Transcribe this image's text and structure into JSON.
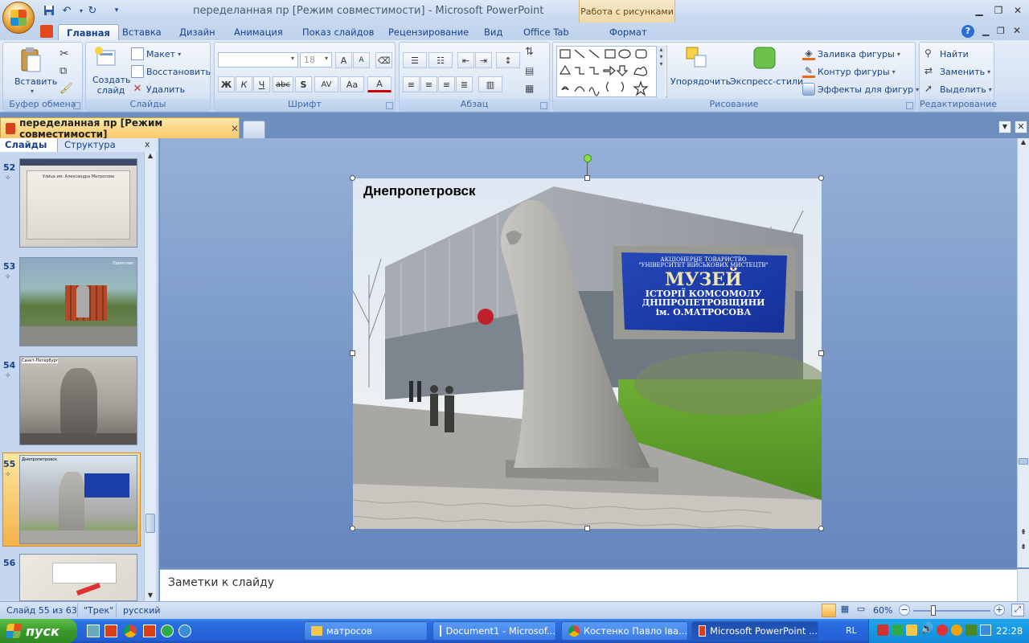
{
  "titlebar": {
    "title": "переделанная пр [Режим совместимости] - Microsoft PowerPoint",
    "context_tab_title": "Работа с рисунками"
  },
  "tabs": [
    {
      "label": "Главная",
      "active": true
    },
    {
      "label": "Вставка"
    },
    {
      "label": "Дизайн"
    },
    {
      "label": "Анимация"
    },
    {
      "label": "Показ слайдов"
    },
    {
      "label": "Рецензирование"
    },
    {
      "label": "Вид"
    },
    {
      "label": "Office Tab"
    },
    {
      "label": "Формат"
    }
  ],
  "ribbon": {
    "clipboard": {
      "label": "Буфер обмена",
      "paste": "Вставить"
    },
    "slides": {
      "label": "Слайды",
      "new_slide": "Создать слайд",
      "layout": "Макет",
      "reset": "Восстановить",
      "delete": "Удалить"
    },
    "font": {
      "label": "Шрифт",
      "size": "18",
      "grow": "A",
      "shrink": "A",
      "bold": "Ж",
      "italic": "К",
      "underline": "Ч",
      "strike": "abc",
      "shadow": "S",
      "spacing": "AV",
      "case": "Aa",
      "color": "A"
    },
    "paragraph": {
      "label": "Абзац"
    },
    "drawing": {
      "label": "Рисование",
      "arrange": "Упорядочить",
      "quick_styles": "Экспресс-стили",
      "fill": "Заливка фигуры",
      "outline": "Контур фигуры",
      "effects": "Эффекты для фигур"
    },
    "editing": {
      "label": "Редактирование",
      "find": "Найти",
      "replace": "Заменить",
      "select": "Выделить"
    }
  },
  "doc_tab": {
    "title": "переделанная пр [Режим совместимости]"
  },
  "panel": {
    "tab_slides": "Слайды",
    "tab_outline": "Структура",
    "close": "x",
    "thumbnails": [
      {
        "num": "52",
        "caption": "Улица им. Александра Матросова"
      },
      {
        "num": "53",
        "caption": "Памятник"
      },
      {
        "num": "54",
        "caption": "Санкт-Петербург"
      },
      {
        "num": "55",
        "caption": "Днепропетровск",
        "selected": true
      },
      {
        "num": "56",
        "caption": ""
      }
    ]
  },
  "slide": {
    "title": "Днепропетровск",
    "sign_line1": "АКЦІОНЕРНЕ ТОВАРИСТВО",
    "sign_line2": "\"УНІВЕРСИТЕТ ВІЙСЬКОВИХ МИСТЕЦТВ\"",
    "sign_line3": "МУЗЕЙ",
    "sign_line4": "ІСТОРІЇ КОМСОМОЛУ",
    "sign_line5": "ДНІПРОПЕТРОВЩИНИ",
    "sign_line6": "ім. О.МАТРОСОВА"
  },
  "notes": {
    "placeholder": "Заметки к слайду"
  },
  "status": {
    "slide_info": "Слайд 55 из 63",
    "theme": "\"Трек\"",
    "language": "русский",
    "zoom": "60%",
    "zoom_level": 0.6
  },
  "taskbar": {
    "start": "пуск",
    "tasks": [
      {
        "label": "матросов"
      },
      {
        "label": "Document1 - Microsof..."
      },
      {
        "label": "Костенко Павло Іва..."
      },
      {
        "label": "Microsoft PowerPoint ...",
        "active": true
      }
    ],
    "lang": "RL",
    "clock": "22:28"
  },
  "colors": {
    "accent": "#15428b",
    "selection": "#f5b24a",
    "sign_blue": "#1a3ea8"
  }
}
